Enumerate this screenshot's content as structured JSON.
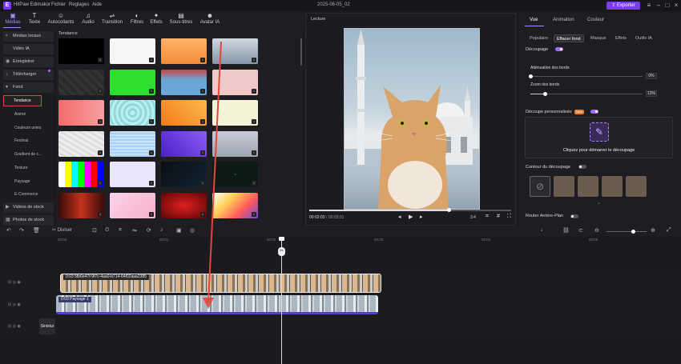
{
  "app": {
    "name": "HitPaw Edimakor",
    "menu": [
      "Fichier",
      "Reglages",
      "Aide"
    ],
    "doc_title": "2025-06-05_02",
    "export_label": "Exporter"
  },
  "toolbar": {
    "tools": [
      {
        "label": "Médias",
        "icon": "folder-icon"
      },
      {
        "label": "Texte",
        "icon": "text-icon"
      },
      {
        "label": "Autocollants",
        "icon": "sticker-icon"
      },
      {
        "label": "Audio",
        "icon": "music-icon"
      },
      {
        "label": "Transition",
        "icon": "transition-icon"
      },
      {
        "label": "Filtres",
        "icon": "filter-icon"
      },
      {
        "label": "Effets",
        "icon": "sparkle-icon"
      },
      {
        "label": "Sous-titres",
        "icon": "subtitle-icon"
      },
      {
        "label": "Avatar IA",
        "icon": "avatar-icon"
      }
    ]
  },
  "sidebar": {
    "items": [
      {
        "label": "Médias locaux",
        "icon": "folder-icon"
      },
      {
        "label": "Vidéo IA",
        "icon": ""
      },
      {
        "label": "Enregistrer",
        "icon": "record-icon"
      },
      {
        "label": "Télécharger",
        "icon": "download-icon"
      },
      {
        "label": "Fond",
        "icon": "chevron-down-icon"
      }
    ],
    "sub_items": [
      "Tendance",
      "Animé",
      "Couleurs unies",
      "Festival",
      "Gradient de c...",
      "Texture",
      "Paysage",
      "E-Commerce"
    ],
    "bottom_items": [
      {
        "label": "Vidéos de stock",
        "icon": "video-icon"
      },
      {
        "label": "Photos de stock",
        "icon": "photo-icon"
      }
    ]
  },
  "grid": {
    "title": "Tendance"
  },
  "preview": {
    "label": "Lecture",
    "time_current": "00:02:03",
    "time_total": "00:03:01",
    "ratio": "3:4",
    "progress": 0.69
  },
  "right_panel": {
    "tabs": [
      "Vue",
      "Animation",
      "Couleur"
    ],
    "sub_tabs": [
      "Populaire",
      "Effacer fond",
      "Masque",
      "Effets",
      "Outils IA"
    ],
    "decoupage_label": "Découpage",
    "attenuation": {
      "label": "Atténuation des bords",
      "value": "0%",
      "level": 0
    },
    "zoom": {
      "label": "Zoom des bords",
      "value": "13%",
      "level": 0.13
    },
    "custom_label": "Découpe personnalisée",
    "custom_badge": "New",
    "custom_hint": "Cliquez pour démarrer le découpage",
    "contour_label": "Contour du découpage",
    "router_label": "Router Arrière-Plan"
  },
  "timeline": {
    "toolbar": {
      "split_label": "Diviser"
    },
    "ruler": [
      "00:00",
      "00:01",
      "00:02",
      "00:03",
      "00:04",
      "00:05"
    ],
    "clip1_label": "0:03 5fb6e47f-9f7c-4aa0-b714-64f02aaa2385",
    "clip2_label": "0:03 Paysage 1",
    "text_clip": "Sinistur"
  },
  "colors": {
    "accent": "#7b3cf0",
    "highlight": "#d9493c"
  }
}
